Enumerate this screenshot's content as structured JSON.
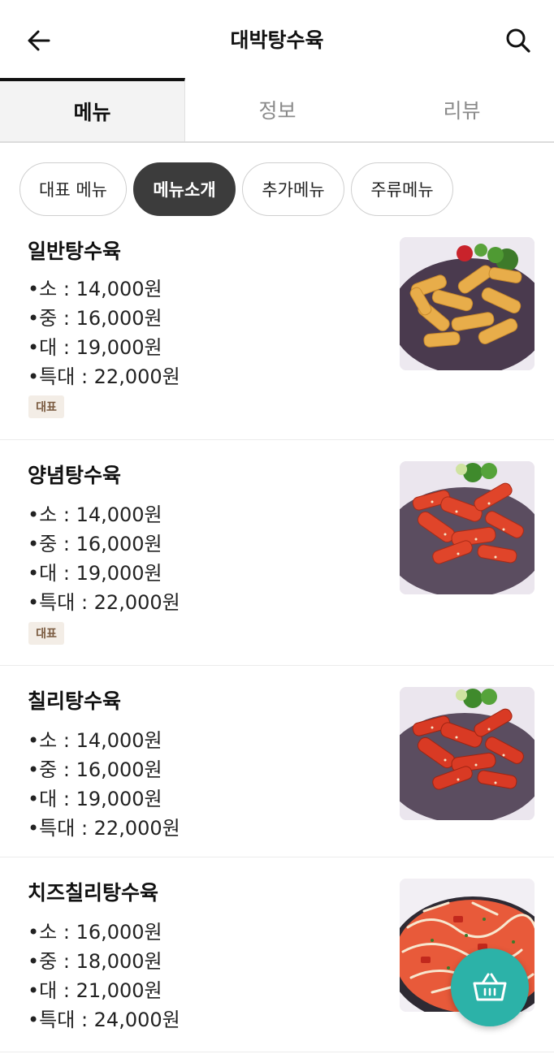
{
  "header": {
    "title": "대박탕수육",
    "back_icon": "arrow-left-icon",
    "search_icon": "search-icon"
  },
  "tabs": [
    {
      "label": "메뉴",
      "active": true
    },
    {
      "label": "정보",
      "active": false
    },
    {
      "label": "리뷰",
      "active": false
    }
  ],
  "chips": [
    {
      "label": "대표 메뉴",
      "active": false
    },
    {
      "label": "메뉴소개",
      "active": true
    },
    {
      "label": "추가메뉴",
      "active": false
    },
    {
      "label": "주류메뉴",
      "active": false
    }
  ],
  "menu": [
    {
      "name": "일반탕수육",
      "prices": [
        "•소 : 14,000원",
        "•중 : 16,000원",
        "•대 : 19,000원",
        "•특대 : 22,000원"
      ],
      "badge": "대표",
      "image": "sweet-and-sour-pork-plain"
    },
    {
      "name": "양념탕수육",
      "prices": [
        "•소 : 14,000원",
        "•중 : 16,000원",
        "•대 : 19,000원",
        "•특대 : 22,000원"
      ],
      "badge": "대표",
      "image": "sauced-sweet-and-sour-pork"
    },
    {
      "name": "칠리탕수육",
      "prices": [
        "•소 : 14,000원",
        "•중 : 16,000원",
        "•대 : 19,000원",
        "•특대 : 22,000원"
      ],
      "badge": "",
      "image": "chili-sweet-and-sour-pork"
    },
    {
      "name": "치즈칠리탕수육",
      "prices": [
        "•소 : 16,000원",
        "•중 : 18,000원",
        "•대 : 21,000원",
        "•특대 : 24,000원"
      ],
      "badge": "",
      "image": "cheese-chili-sweet-and-sour-pork"
    }
  ],
  "cart": {
    "icon": "basket-icon"
  },
  "colors": {
    "accent": "#2cb2a8",
    "chip_active": "#3c3c3c",
    "badge_bg": "#f3ede6",
    "badge_text": "#7a5a3f"
  }
}
